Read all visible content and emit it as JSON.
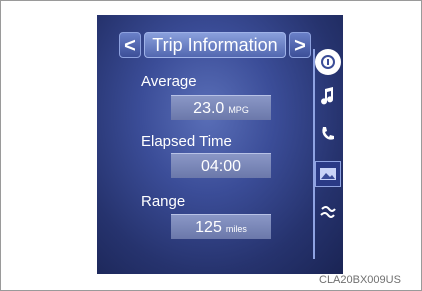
{
  "header": {
    "title": "Trip Information",
    "prev_icon": "chevron-left-icon",
    "next_icon": "chevron-right-icon",
    "prev_glyph": "<",
    "next_glyph": ">"
  },
  "metrics": [
    {
      "label": "Average",
      "value": "23.0",
      "unit": "MPG"
    },
    {
      "label": "Elapsed Time",
      "value": "04:00",
      "unit": ""
    },
    {
      "label": "Range",
      "value": "125",
      "unit": "miles"
    }
  ],
  "side_menu": {
    "items": [
      {
        "icon": "info-icon"
      },
      {
        "icon": "music-note-icon"
      },
      {
        "icon": "phone-icon"
      },
      {
        "icon": "image-icon"
      },
      {
        "icon": "climate-icon"
      }
    ]
  },
  "caption": "CLA20BX009US",
  "colors": {
    "screen_bg": "#3b4d98",
    "highlight": "#8aa0dc",
    "value_box": "#7a87b8"
  }
}
